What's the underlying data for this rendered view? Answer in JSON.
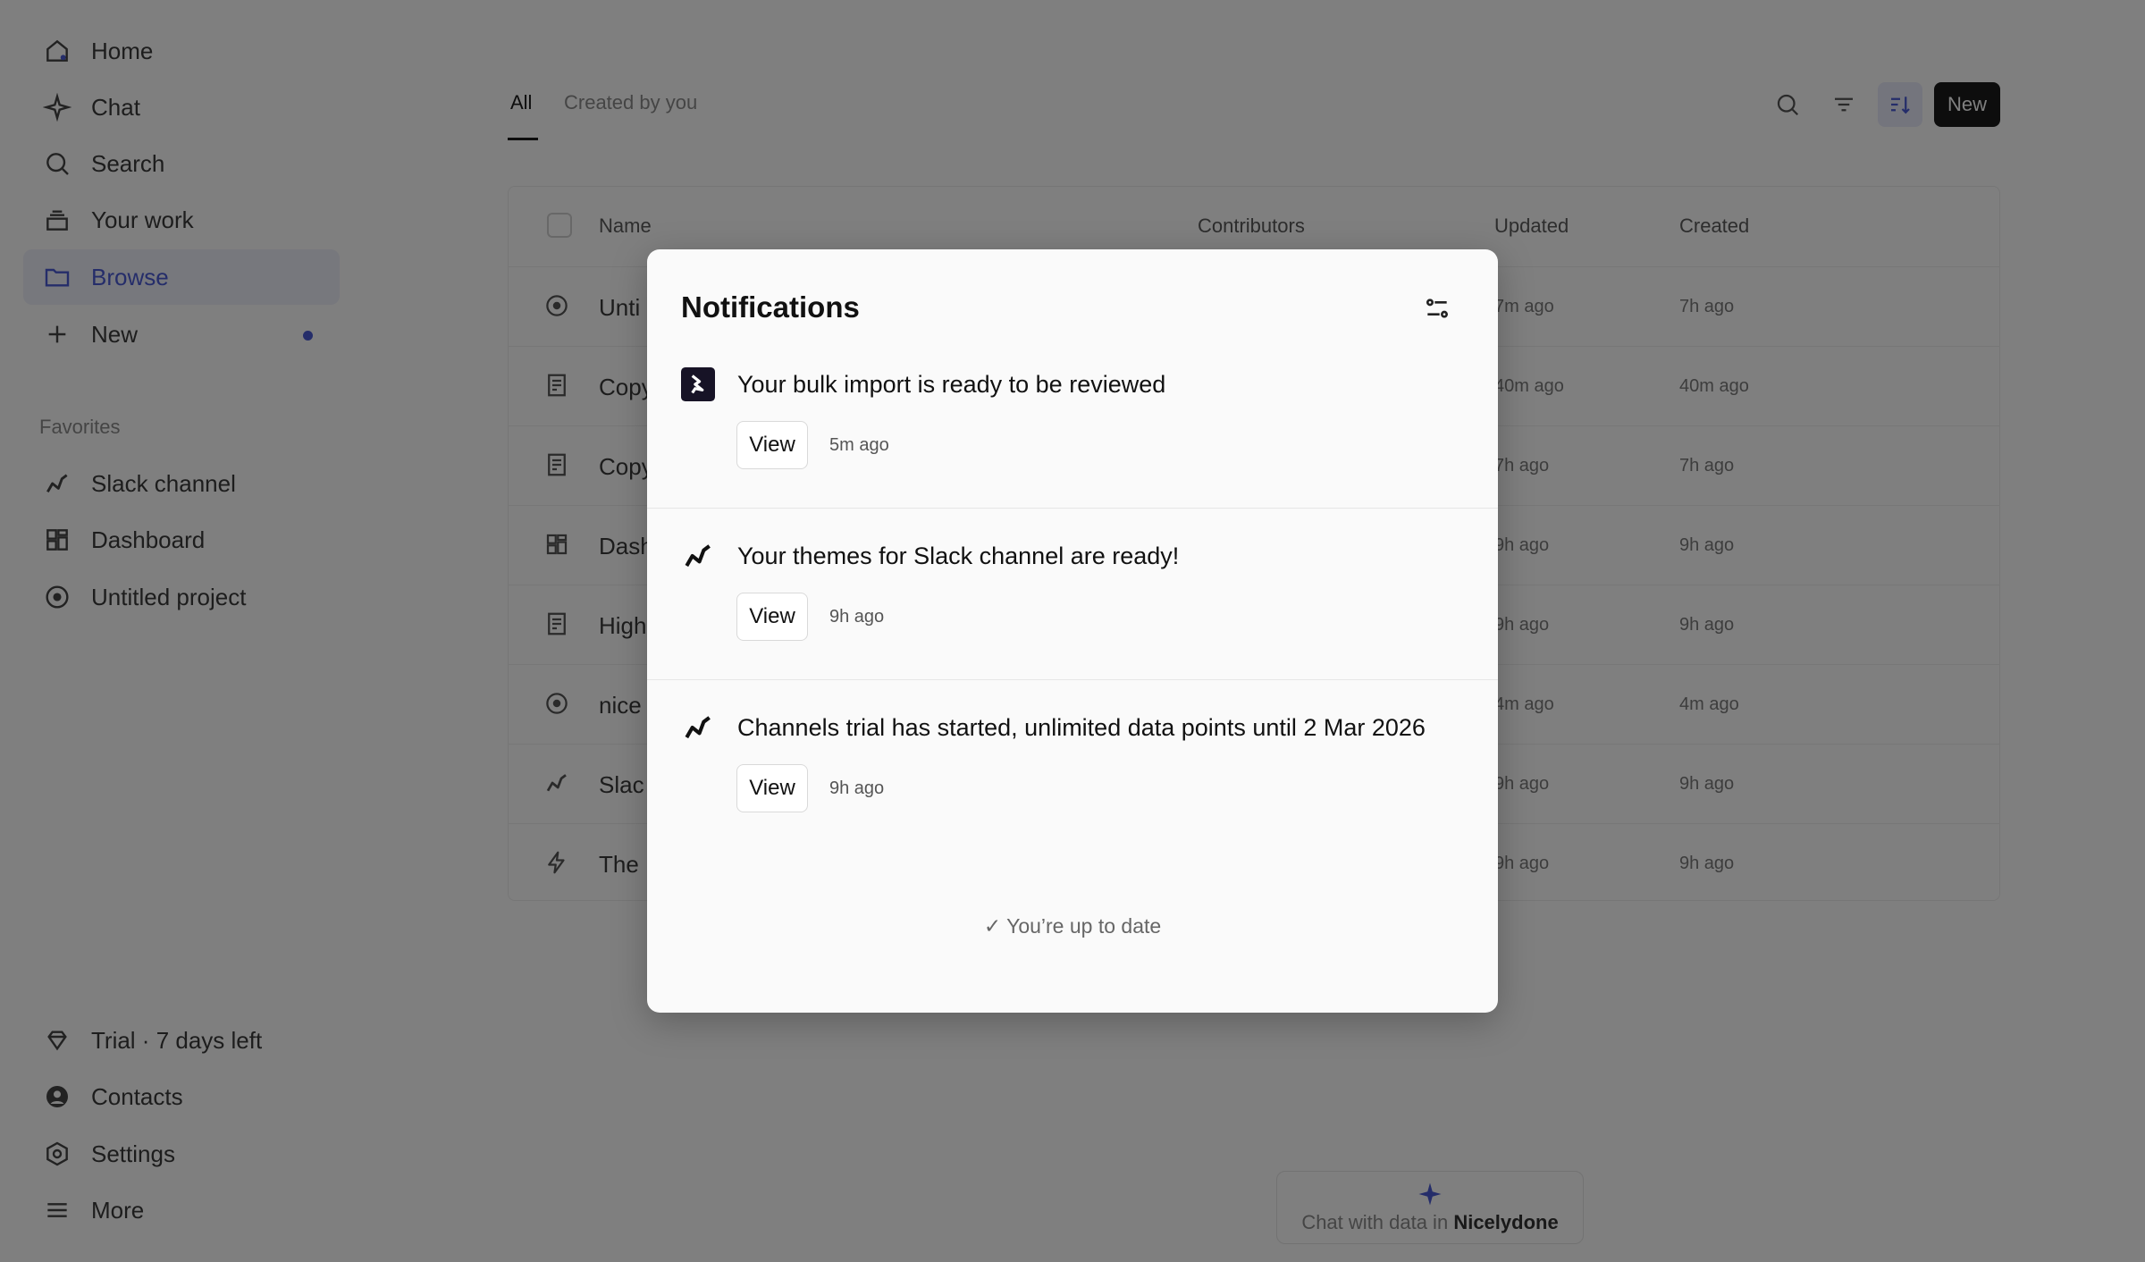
{
  "sidebar": {
    "nav": [
      {
        "label": "Home",
        "icon": "home-icon"
      },
      {
        "label": "Chat",
        "icon": "sparkle-icon"
      },
      {
        "label": "Search",
        "icon": "search-icon"
      },
      {
        "label": "Your work",
        "icon": "stack-icon"
      },
      {
        "label": "Browse",
        "icon": "folder-icon",
        "active": true
      },
      {
        "label": "New",
        "icon": "plus-icon",
        "badge_dot": true
      }
    ],
    "favorites_label": "Favorites",
    "favorites": [
      {
        "label": "Slack channel",
        "icon": "trend-icon"
      },
      {
        "label": "Dashboard",
        "icon": "dashboard-icon"
      },
      {
        "label": "Untitled project",
        "icon": "compass-icon"
      }
    ],
    "bottom": [
      {
        "label": "Trial · 7 days left",
        "icon": "diamond-icon"
      },
      {
        "label": "Contacts",
        "icon": "user-icon"
      },
      {
        "label": "Settings",
        "icon": "settings-icon"
      },
      {
        "label": "More",
        "icon": "menu-icon"
      }
    ]
  },
  "main": {
    "tabs": [
      {
        "label": "All",
        "active": true
      },
      {
        "label": "Created by you",
        "active": false
      }
    ],
    "new_button": "New",
    "table": {
      "columns": [
        "Name",
        "Contributors",
        "Updated",
        "Created"
      ],
      "rows": [
        {
          "name": "Unti",
          "icon": "compass-icon",
          "updated": "7m ago",
          "created": "7h ago"
        },
        {
          "name": "Copy",
          "icon": "document-icon",
          "updated": "40m ago",
          "created": "40m ago"
        },
        {
          "name": "Copy",
          "icon": "document-icon",
          "updated": "7h ago",
          "created": "7h ago"
        },
        {
          "name": "Dash",
          "icon": "dashboard-icon",
          "updated": "9h ago",
          "created": "9h ago"
        },
        {
          "name": "High",
          "icon": "document-icon",
          "updated": "9h ago",
          "created": "9h ago"
        },
        {
          "name": "nice",
          "icon": "compass-icon",
          "updated": "4m ago",
          "created": "4m ago"
        },
        {
          "name": "Slac",
          "icon": "trend-icon",
          "updated": "9h ago",
          "created": "9h ago"
        },
        {
          "name": "The",
          "icon": "bolt-icon",
          "updated": "9h ago",
          "created": "9h ago"
        }
      ]
    },
    "chat_pill": {
      "prefix": "Chat with data in",
      "workspace": "Nicelydone"
    }
  },
  "notifications": {
    "title": "Notifications",
    "items": [
      {
        "text": "Your bulk import is ready to be reviewed",
        "icon": "app-logo-icon",
        "action": "View",
        "time": "5m ago"
      },
      {
        "text": "Your themes for Slack channel are ready!",
        "icon": "trend-icon",
        "action": "View",
        "time": "9h ago"
      },
      {
        "text": "Channels trial has started, unlimited data points until 2 Mar 2026",
        "icon": "trend-icon",
        "action": "View",
        "time": "9h ago"
      }
    ],
    "footer": "You’re up to date"
  },
  "colors": {
    "accent": "#4a5bd4",
    "overlay": "rgba(0,0,0,0.5)"
  }
}
